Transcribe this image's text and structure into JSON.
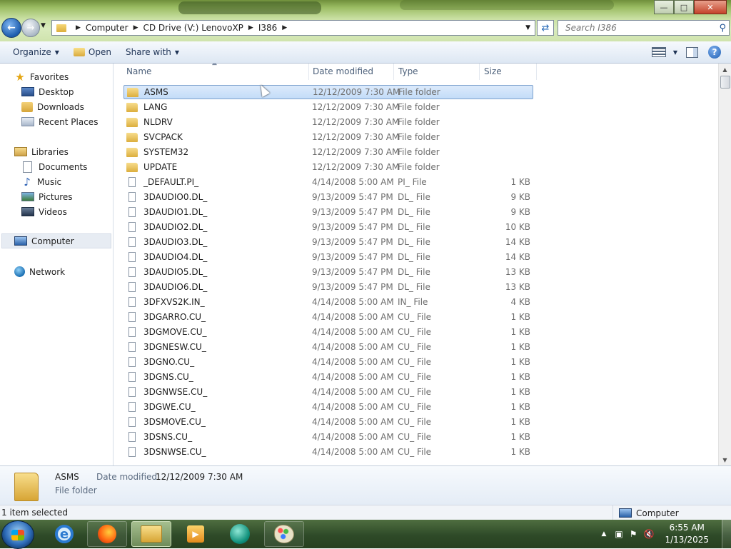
{
  "window": {
    "buttons": {
      "minimize": "—",
      "maximize": "□",
      "close": "✕"
    }
  },
  "address": {
    "crumbs": [
      "Computer",
      "CD Drive (V:) LenovoXP",
      "I386"
    ]
  },
  "search": {
    "placeholder": "Search I386"
  },
  "commands": {
    "organize": "Organize",
    "open": "Open",
    "share_with": "Share with"
  },
  "nav": {
    "favorites": "Favorites",
    "desktop": "Desktop",
    "downloads": "Downloads",
    "recent_places": "Recent Places",
    "libraries": "Libraries",
    "documents": "Documents",
    "music": "Music",
    "pictures": "Pictures",
    "videos": "Videos",
    "computer": "Computer",
    "network": "Network"
  },
  "columns": {
    "name": "Name",
    "date_modified": "Date modified",
    "type": "Type",
    "size": "Size"
  },
  "files": [
    {
      "name": "ASMS",
      "date": "12/12/2009 7:30 AM",
      "type": "File folder",
      "size": "",
      "kind": "folder",
      "selected": true
    },
    {
      "name": "LANG",
      "date": "12/12/2009 7:30 AM",
      "type": "File folder",
      "size": "",
      "kind": "folder"
    },
    {
      "name": "NLDRV",
      "date": "12/12/2009 7:30 AM",
      "type": "File folder",
      "size": "",
      "kind": "folder"
    },
    {
      "name": "SVCPACK",
      "date": "12/12/2009 7:30 AM",
      "type": "File folder",
      "size": "",
      "kind": "folder"
    },
    {
      "name": "SYSTEM32",
      "date": "12/12/2009 7:30 AM",
      "type": "File folder",
      "size": "",
      "kind": "folder"
    },
    {
      "name": "UPDATE",
      "date": "12/12/2009 7:30 AM",
      "type": "File folder",
      "size": "",
      "kind": "folder"
    },
    {
      "name": "_DEFAULT.PI_",
      "date": "4/14/2008 5:00 AM",
      "type": "PI_ File",
      "size": "1 KB",
      "kind": "file"
    },
    {
      "name": "3DAUDIO0.DL_",
      "date": "9/13/2009 5:47 PM",
      "type": "DL_ File",
      "size": "9 KB",
      "kind": "file"
    },
    {
      "name": "3DAUDIO1.DL_",
      "date": "9/13/2009 5:47 PM",
      "type": "DL_ File",
      "size": "9 KB",
      "kind": "file"
    },
    {
      "name": "3DAUDIO2.DL_",
      "date": "9/13/2009 5:47 PM",
      "type": "DL_ File",
      "size": "10 KB",
      "kind": "file"
    },
    {
      "name": "3DAUDIO3.DL_",
      "date": "9/13/2009 5:47 PM",
      "type": "DL_ File",
      "size": "14 KB",
      "kind": "file"
    },
    {
      "name": "3DAUDIO4.DL_",
      "date": "9/13/2009 5:47 PM",
      "type": "DL_ File",
      "size": "14 KB",
      "kind": "file"
    },
    {
      "name": "3DAUDIO5.DL_",
      "date": "9/13/2009 5:47 PM",
      "type": "DL_ File",
      "size": "13 KB",
      "kind": "file"
    },
    {
      "name": "3DAUDIO6.DL_",
      "date": "9/13/2009 5:47 PM",
      "type": "DL_ File",
      "size": "13 KB",
      "kind": "file"
    },
    {
      "name": "3DFXVS2K.IN_",
      "date": "4/14/2008 5:00 AM",
      "type": "IN_ File",
      "size": "4 KB",
      "kind": "file"
    },
    {
      "name": "3DGARRO.CU_",
      "date": "4/14/2008 5:00 AM",
      "type": "CU_ File",
      "size": "1 KB",
      "kind": "file"
    },
    {
      "name": "3DGMOVE.CU_",
      "date": "4/14/2008 5:00 AM",
      "type": "CU_ File",
      "size": "1 KB",
      "kind": "file"
    },
    {
      "name": "3DGNESW.CU_",
      "date": "4/14/2008 5:00 AM",
      "type": "CU_ File",
      "size": "1 KB",
      "kind": "file"
    },
    {
      "name": "3DGNO.CU_",
      "date": "4/14/2008 5:00 AM",
      "type": "CU_ File",
      "size": "1 KB",
      "kind": "file"
    },
    {
      "name": "3DGNS.CU_",
      "date": "4/14/2008 5:00 AM",
      "type": "CU_ File",
      "size": "1 KB",
      "kind": "file"
    },
    {
      "name": "3DGNWSE.CU_",
      "date": "4/14/2008 5:00 AM",
      "type": "CU_ File",
      "size": "1 KB",
      "kind": "file"
    },
    {
      "name": "3DGWE.CU_",
      "date": "4/14/2008 5:00 AM",
      "type": "CU_ File",
      "size": "1 KB",
      "kind": "file"
    },
    {
      "name": "3DSMOVE.CU_",
      "date": "4/14/2008 5:00 AM",
      "type": "CU_ File",
      "size": "1 KB",
      "kind": "file"
    },
    {
      "name": "3DSNS.CU_",
      "date": "4/14/2008 5:00 AM",
      "type": "CU_ File",
      "size": "1 KB",
      "kind": "file"
    },
    {
      "name": "3DSNWSE.CU_",
      "date": "4/14/2008 5:00 AM",
      "type": "CU_ File",
      "size": "1 KB",
      "kind": "file"
    }
  ],
  "details": {
    "name": "ASMS",
    "date_label": "Date modified:",
    "date_value": "12/12/2009 7:30 AM",
    "type": "File folder"
  },
  "status": {
    "selection": "1 item selected",
    "location": "Computer"
  },
  "clock": {
    "time": "6:55 AM",
    "date": "1/13/2025"
  },
  "colors": {
    "selection_fill": "#c3dcf8",
    "selection_border": "#7da2ce",
    "folder": "#dcae3d",
    "taskbar": "#2e4a28"
  }
}
